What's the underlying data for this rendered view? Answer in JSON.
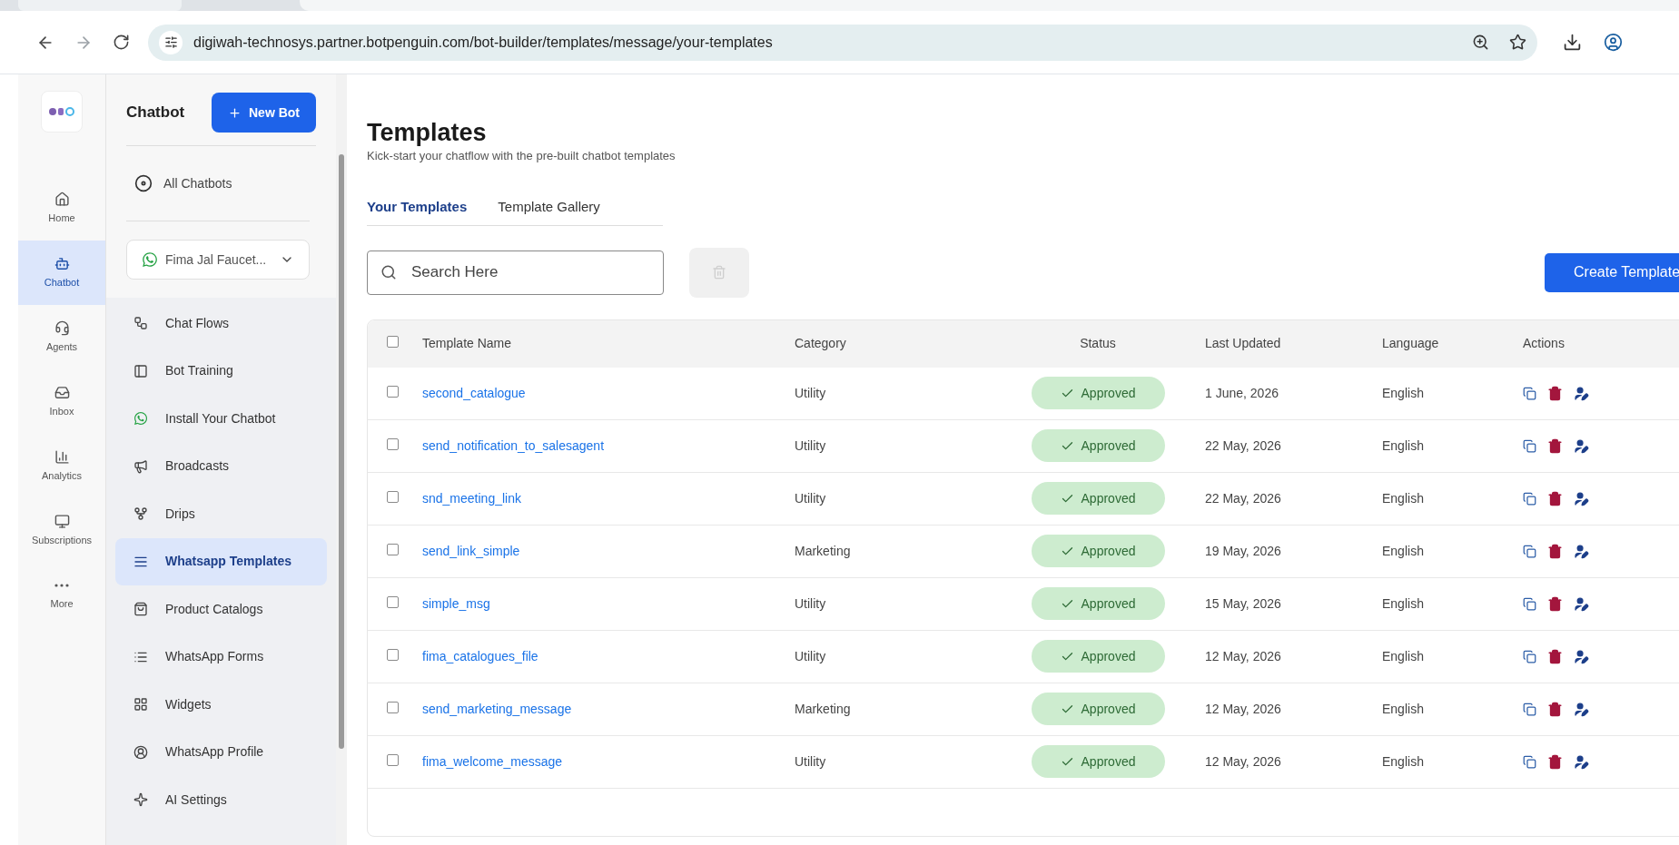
{
  "browser": {
    "url": "digiwah-technosys.partner.botpenguin.com/bot-builder/templates/message/your-templates"
  },
  "nav_rail": [
    {
      "label": "Home",
      "selected": false
    },
    {
      "label": "Chatbot",
      "selected": true
    },
    {
      "label": "Agents",
      "selected": false
    },
    {
      "label": "Inbox",
      "selected": false
    },
    {
      "label": "Analytics",
      "selected": false
    },
    {
      "label": "Subscriptions",
      "selected": false
    },
    {
      "label": "More",
      "selected": false
    }
  ],
  "sidebar": {
    "title": "Chatbot",
    "new_bot_button": "New Bot",
    "all_chatbots": "All Chatbots",
    "bot_select": "Fima Jal Faucet...",
    "items": [
      {
        "label": "Chat Flows",
        "selected": false
      },
      {
        "label": "Bot Training",
        "selected": false
      },
      {
        "label": "Install Your Chatbot",
        "selected": false
      },
      {
        "label": "Broadcasts",
        "selected": false
      },
      {
        "label": "Drips",
        "selected": false
      },
      {
        "label": "Whatsapp Templates",
        "selected": true
      },
      {
        "label": "Product Catalogs",
        "selected": false
      },
      {
        "label": "WhatsApp Forms",
        "selected": false
      },
      {
        "label": "Widgets",
        "selected": false
      },
      {
        "label": "WhatsApp Profile",
        "selected": false
      },
      {
        "label": "AI Settings",
        "selected": false
      }
    ]
  },
  "page": {
    "title": "Templates",
    "subtitle": "Kick-start your chatflow with the pre-built chatbot templates",
    "tabs": [
      {
        "label": "Your Templates",
        "selected": true
      },
      {
        "label": "Template Gallery",
        "selected": false
      }
    ],
    "search": {
      "placeholder": "Search Here"
    },
    "create_button": "Create Template"
  },
  "table": {
    "header_checked": false,
    "columns": [
      "Template Name",
      "Category",
      "Status",
      "Last Updated",
      "Language",
      "Actions"
    ],
    "rows": [
      {
        "checked": false,
        "name": "second_catalogue",
        "category": "Utility",
        "status": "Approved",
        "updated": "1 June, 2026",
        "language": "English"
      },
      {
        "checked": false,
        "name": "send_notification_to_salesagent",
        "category": "Utility",
        "status": "Approved",
        "updated": "22 May, 2026",
        "language": "English"
      },
      {
        "checked": false,
        "name": "snd_meeting_link",
        "category": "Utility",
        "status": "Approved",
        "updated": "22 May, 2026",
        "language": "English"
      },
      {
        "checked": false,
        "name": "send_link_simple",
        "category": "Marketing",
        "status": "Approved",
        "updated": "19 May, 2026",
        "language": "English"
      },
      {
        "checked": false,
        "name": "simple_msg",
        "category": "Utility",
        "status": "Approved",
        "updated": "15 May, 2026",
        "language": "English"
      },
      {
        "checked": false,
        "name": "fima_catalogues_file",
        "category": "Utility",
        "status": "Approved",
        "updated": "12 May, 2026",
        "language": "English"
      },
      {
        "checked": false,
        "name": "send_marketing_message",
        "category": "Marketing",
        "status": "Approved",
        "updated": "12 May, 2026",
        "language": "English"
      },
      {
        "checked": false,
        "name": "fima_welcome_message",
        "category": "Utility",
        "status": "Approved",
        "updated": "12 May, 2026",
        "language": "English"
      }
    ]
  }
}
